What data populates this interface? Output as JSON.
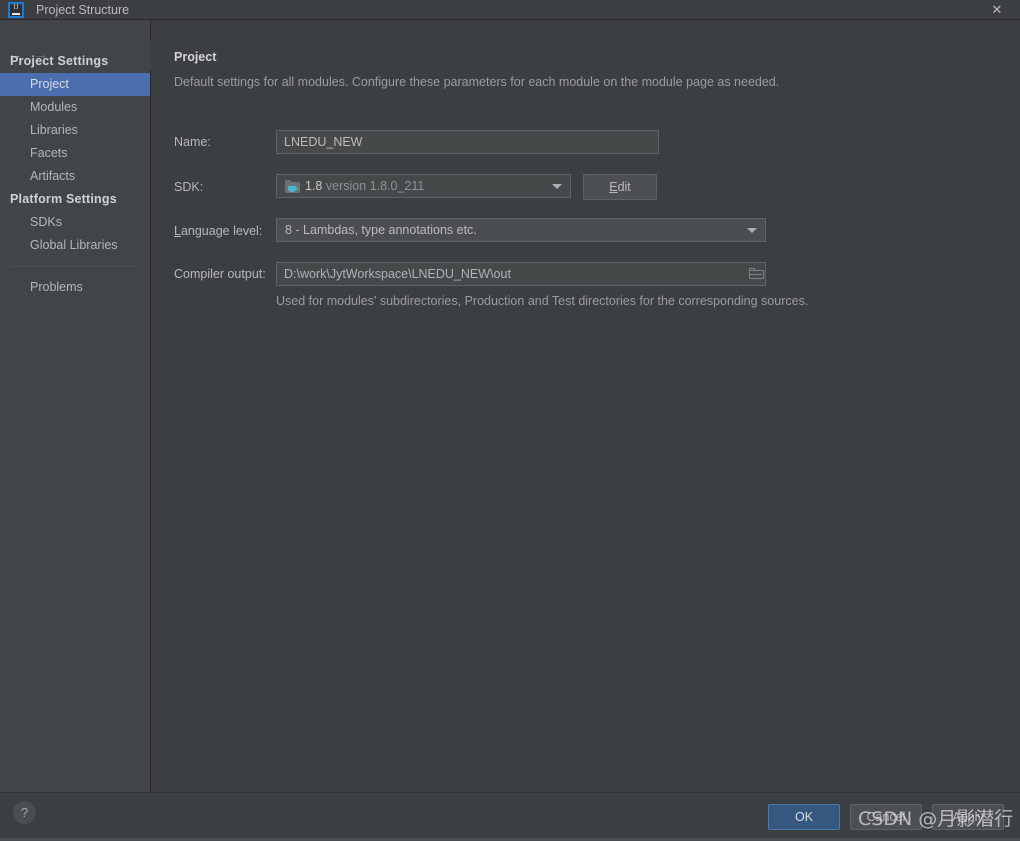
{
  "window": {
    "title": "Project Structure",
    "logo_icon": "intellij-idea-logo",
    "logo_text": "IJ",
    "close_icon": "✕"
  },
  "nav": {
    "back_icon": "←",
    "forward_icon": "→"
  },
  "sidebar": {
    "groups": [
      {
        "label": "Project Settings",
        "items": [
          {
            "label": "Project",
            "selected": true
          },
          {
            "label": "Modules",
            "selected": false
          },
          {
            "label": "Libraries",
            "selected": false
          },
          {
            "label": "Facets",
            "selected": false
          },
          {
            "label": "Artifacts",
            "selected": false
          }
        ]
      },
      {
        "label": "Platform Settings",
        "items": [
          {
            "label": "SDKs",
            "selected": false
          },
          {
            "label": "Global Libraries",
            "selected": false
          }
        ]
      }
    ],
    "extra_items": [
      {
        "label": "Problems",
        "selected": false
      }
    ]
  },
  "main": {
    "title": "Project",
    "subtitle": "Default settings for all modules. Configure these parameters for each module on the module page as needed.",
    "fields": {
      "name": {
        "label": "Name:",
        "value": "LNEDU_NEW",
        "placeholder": ""
      },
      "sdk": {
        "label": "SDK:",
        "icon": "jdk-folder-icon",
        "value_bright": "1.8",
        "value_dim": "version 1.8.0_211",
        "arrow_icon": "chevron-down-icon",
        "edit_button": {
          "prefix": "",
          "mnemonic": "E",
          "suffix": "dit"
        }
      },
      "language_level": {
        "label_mnemonic": "L",
        "label_rest": "anguage level:",
        "value": "8 - Lambdas, type annotations etc.",
        "arrow_icon": "chevron-down-icon"
      },
      "compiler_output": {
        "label": "Compiler output:",
        "value": "D:\\work\\JytWorkspace\\LNEDU_NEW\\out",
        "browse_icon": "folder-browse-icon",
        "hint": "Used for modules' subdirectories, Production and Test directories for the corresponding sources."
      }
    }
  },
  "footer": {
    "help_icon": "?",
    "buttons": [
      {
        "label": "OK",
        "primary": true
      },
      {
        "label": "Cancel",
        "primary": false
      },
      {
        "label": "Apply",
        "primary": false
      }
    ]
  },
  "watermark": {
    "text": "CSDN @月影潜行"
  },
  "colors": {
    "window_bg": "#3c3f41",
    "sidebar_bg": "#41454a",
    "selection_blue": "#4b6eaf",
    "primary_button": "#365880",
    "field_bg": "#45494a",
    "border": "#5e6366",
    "text": "#bbbbbb",
    "text_dim": "#9a9d9f",
    "java_cup": "#4fb3d4"
  }
}
